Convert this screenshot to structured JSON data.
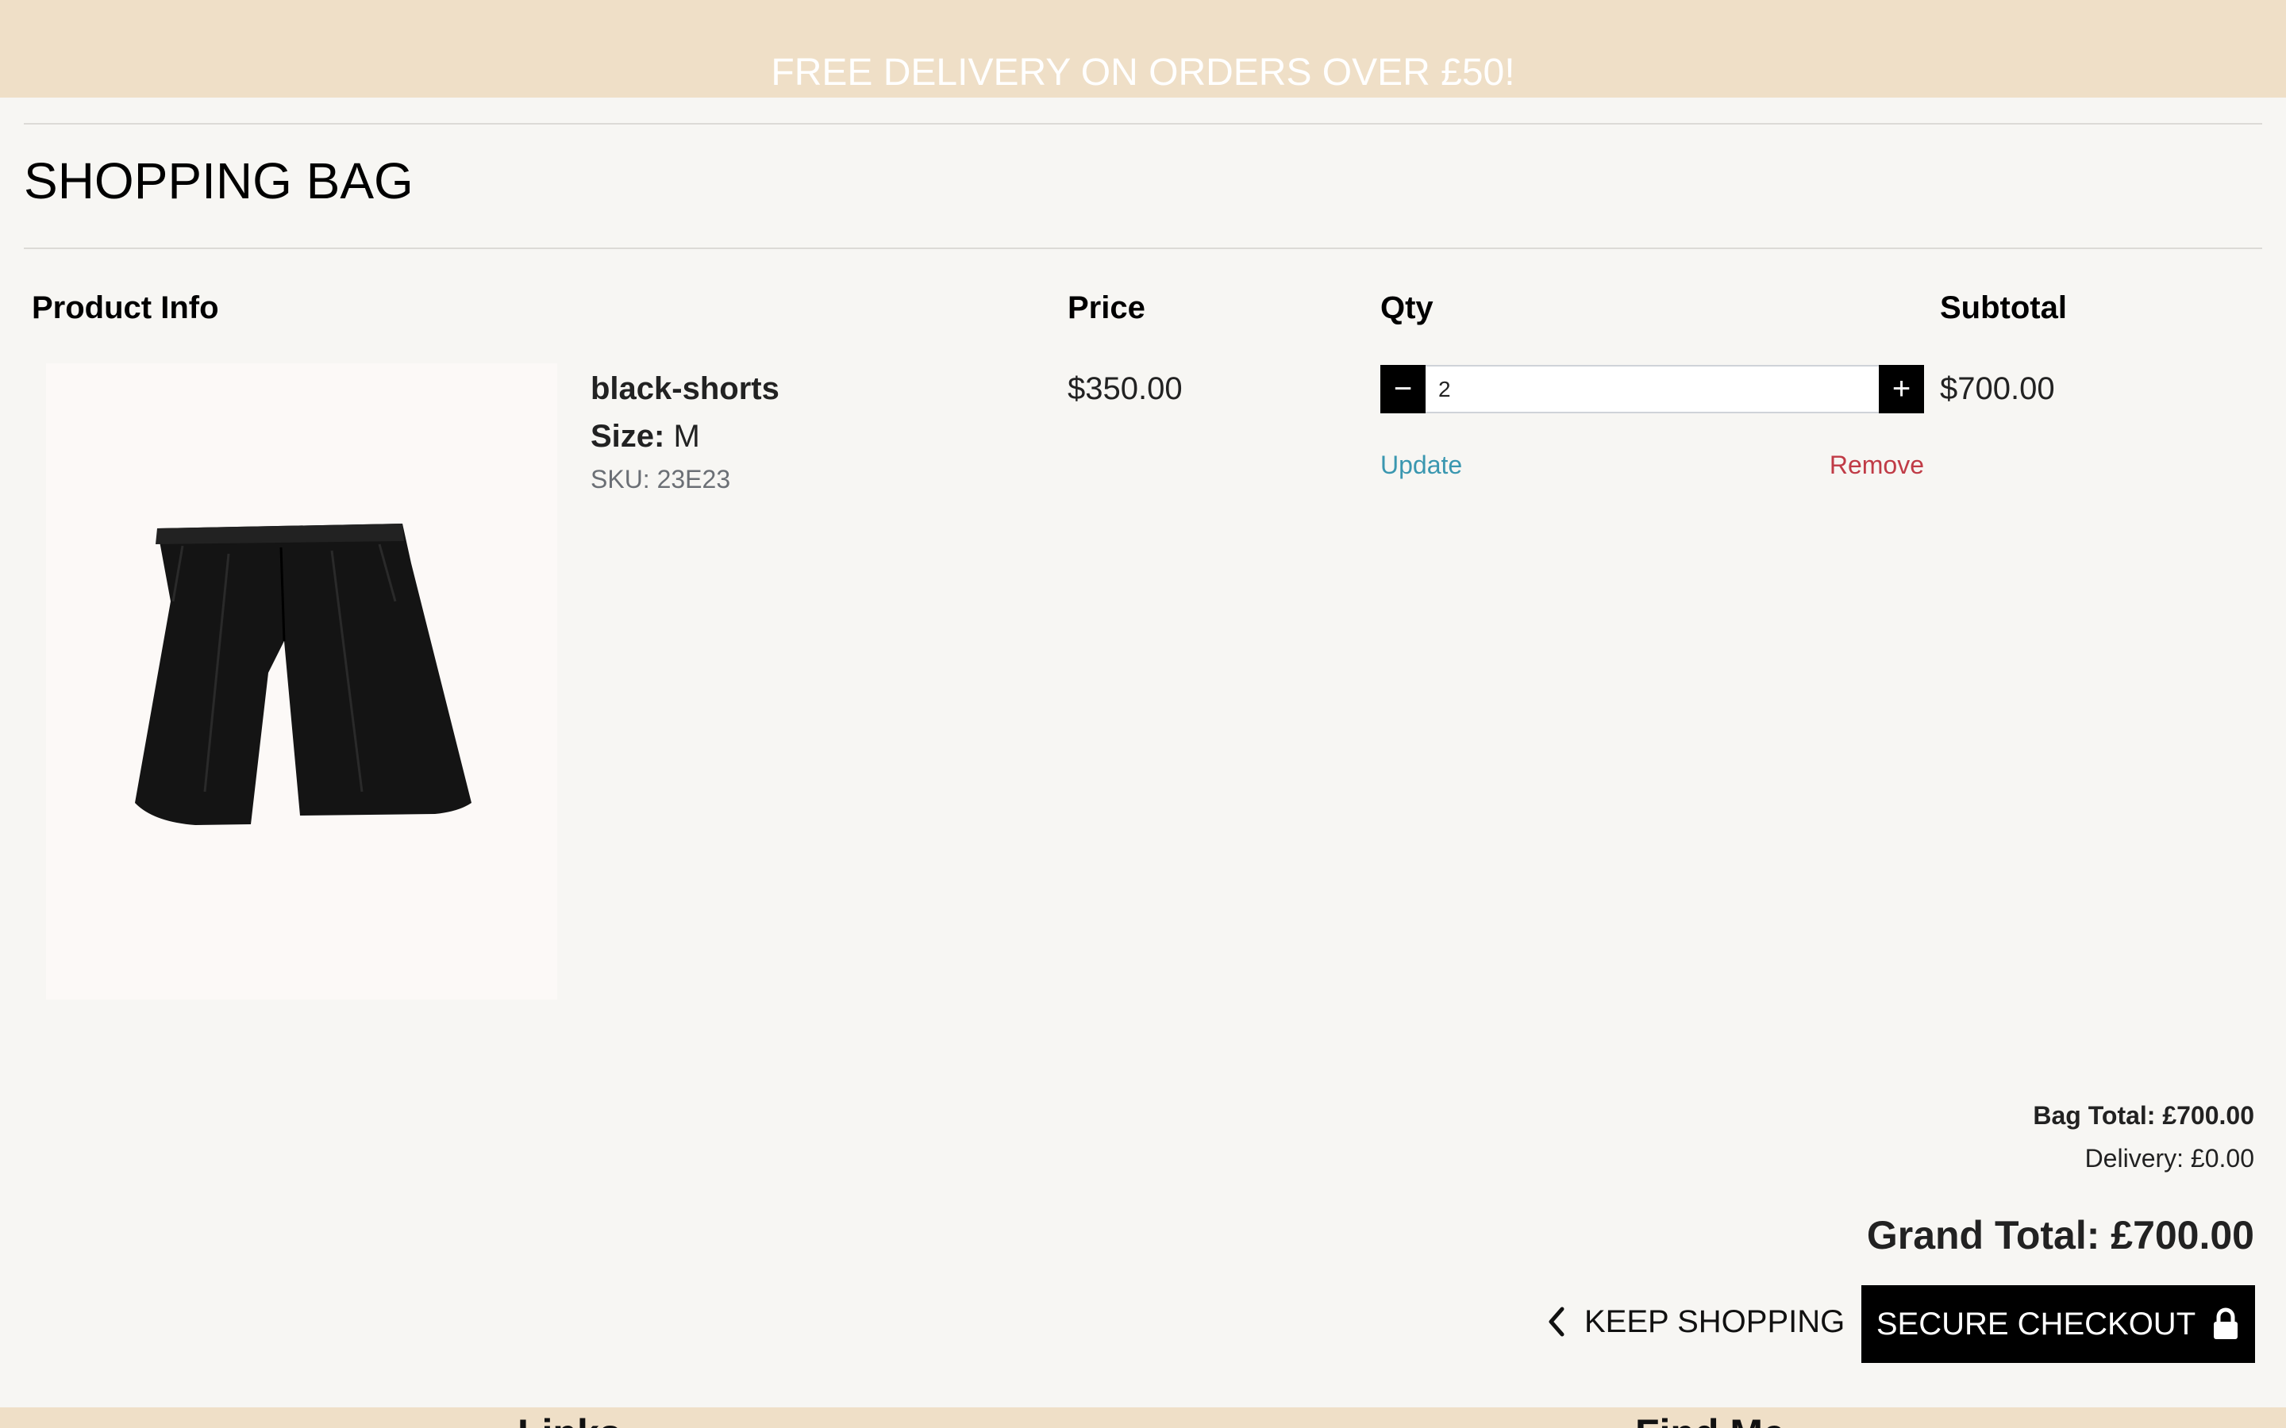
{
  "banner": {
    "text": "FREE DELIVERY ON ORDERS OVER £50!"
  },
  "page": {
    "title": "SHOPPING BAG"
  },
  "table": {
    "headers": {
      "product_info": "Product Info",
      "price": "Price",
      "qty": "Qty",
      "subtotal": "Subtotal"
    },
    "item": {
      "name": "black-shorts",
      "size_label": "Size:",
      "size_value": "M",
      "sku": "SKU: 23E23",
      "price": "$350.00",
      "qty": "2",
      "subtotal": "$700.00",
      "update_label": "Update",
      "remove_label": "Remove",
      "minus_label": "−",
      "plus_label": "+"
    }
  },
  "totals": {
    "bag_total": "Bag Total: £700.00",
    "delivery": "Delivery: £0.00",
    "grand_total": "Grand Total: £700.00"
  },
  "actions": {
    "keep_shopping": "KEEP SHOPPING",
    "checkout": "SECURE CHECKOUT"
  },
  "footer": {
    "links_heading": "Links",
    "find_me_heading": "Find Me"
  },
  "colors": {
    "banner_bg": "#efdfc7",
    "page_bg": "#f7f6f3",
    "update_link": "#3a97b0",
    "remove_link": "#c03b46",
    "button_bg": "#000000"
  },
  "icons": {
    "keep_shopping": "chevron-left-icon",
    "checkout": "lock-icon"
  }
}
